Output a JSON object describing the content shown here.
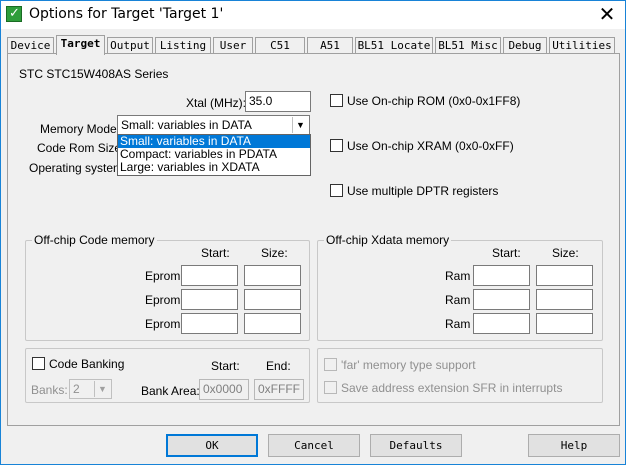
{
  "window": {
    "title": "Options for Target 'Target 1'"
  },
  "tabs": [
    {
      "label": "Device"
    },
    {
      "label": "Target"
    },
    {
      "label": "Output"
    },
    {
      "label": "Listing"
    },
    {
      "label": "User"
    },
    {
      "label": "C51"
    },
    {
      "label": "A51"
    },
    {
      "label": "BL51 Locate"
    },
    {
      "label": "BL51 Misc"
    },
    {
      "label": "Debug"
    },
    {
      "label": "Utilities"
    }
  ],
  "active_tab": "Target",
  "device_name": "STC STC15W408AS Series",
  "xtal": {
    "label": "Xtal (MHz):",
    "value": "35.0"
  },
  "memory_model": {
    "label": "Memory Model:",
    "selected": "Small: variables in DATA",
    "options": [
      "Small: variables in DATA",
      "Compact: variables in PDATA",
      "Large: variables in XDATA"
    ]
  },
  "code_rom": {
    "label": "Code Rom Size:"
  },
  "os": {
    "label": "Operating system:"
  },
  "onchip_rom": {
    "label": "Use On-chip ROM (0x0-0x1FF8)",
    "checked": false
  },
  "onchip_xram": {
    "label": "Use On-chip XRAM (0x0-0xFF)",
    "checked": false
  },
  "dptr": {
    "label": "Use multiple DPTR registers",
    "checked": false
  },
  "code_memory": {
    "title": "Off-chip Code memory",
    "start_header": "Start:",
    "size_header": "Size:",
    "rows": [
      {
        "label": "Eprom"
      },
      {
        "label": "Eprom"
      },
      {
        "label": "Eprom"
      }
    ]
  },
  "xdata_memory": {
    "title": "Off-chip Xdata memory",
    "start_header": "Start:",
    "size_header": "Size:",
    "rows": [
      {
        "label": "Ram"
      },
      {
        "label": "Ram"
      },
      {
        "label": "Ram"
      }
    ]
  },
  "banking": {
    "label": "Code Banking",
    "start_header": "Start:",
    "end_header": "End:",
    "banks_label": "Banks:",
    "banks_value": "2",
    "bank_area_label": "Bank Area:",
    "start_value": "0x0000",
    "end_value": "0xFFFF"
  },
  "far_memory": {
    "label": "'far' memory type support"
  },
  "save_sfr": {
    "label": "Save address extension SFR in interrupts"
  },
  "buttons": {
    "ok": "OK",
    "cancel": "Cancel",
    "defaults": "Defaults",
    "help": "Help"
  }
}
